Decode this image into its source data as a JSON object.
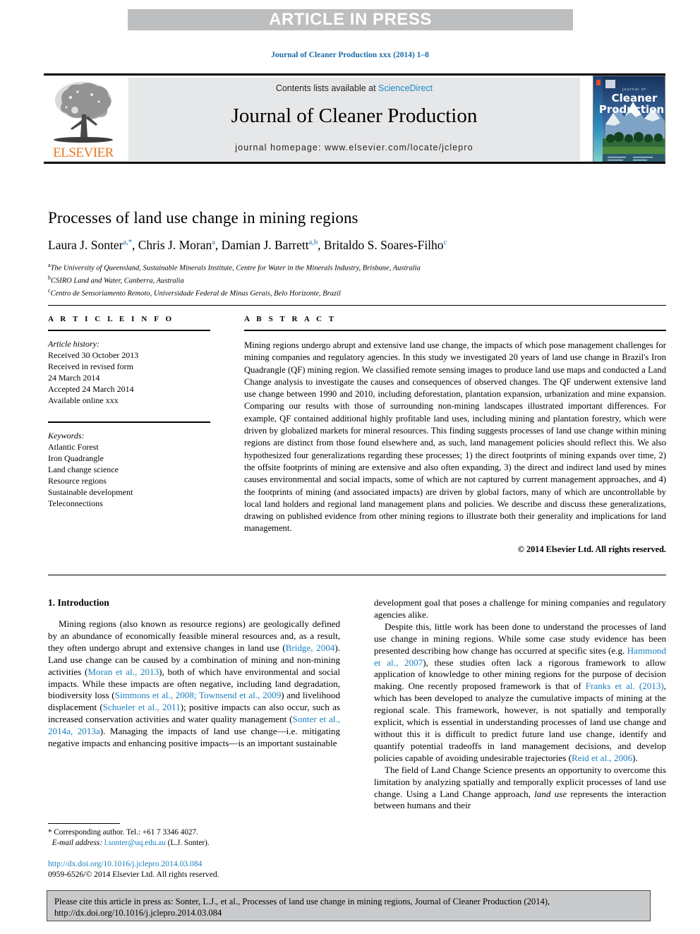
{
  "banner": {
    "text": "ARTICLE IN PRESS"
  },
  "journal_ref": "Journal of Cleaner Production xxx (2014) 1–8",
  "masthead": {
    "contents_prefix": "Contents lists available at ",
    "contents_link": "ScienceDirect",
    "journal_title": "Journal of Cleaner Production",
    "homepage": "journal homepage: www.elsevier.com/locate/jclepro",
    "publisher_word": "ELSEVIER",
    "publisher_color": "#E87722",
    "link_color": "#1b8ac7",
    "cover_title_line1": "Cleaner",
    "cover_title_line2": "Production",
    "cover_overline": "Journal of"
  },
  "article": {
    "title": "Processes of land use change in mining regions",
    "authors": [
      {
        "name": "Laura J. Sonter",
        "sup": "a,*"
      },
      {
        "name": "Chris J. Moran",
        "sup": "a"
      },
      {
        "name": "Damian J. Barrett",
        "sup": "a,b"
      },
      {
        "name": "Britaldo S. Soares-Filho",
        "sup": "c"
      }
    ],
    "affiliations": [
      {
        "marker": "a",
        "text": "The University of Queensland, Sustainable Minerals Institute, Centre for Water in the Minerals Industry, Brisbane, Australia"
      },
      {
        "marker": "b",
        "text": "CSIRO Land and Water, Canberra, Australia"
      },
      {
        "marker": "c",
        "text": "Centro de Sensoriamento Remoto, Universidade Federal de Minas Gerais, Belo Horizonte, Brazil"
      }
    ]
  },
  "info": {
    "heading": "A R T I C L E   I N F O",
    "history_label": "Article history:",
    "history": [
      "Received 30 October 2013",
      "Received in revised form",
      "24 March 2014",
      "Accepted 24 March 2014",
      "Available online xxx"
    ],
    "keywords_label": "Keywords:",
    "keywords": [
      "Atlantic Forest",
      "Iron Quadrangle",
      "Land change science",
      "Resource regions",
      "Sustainable development",
      "Teleconnections"
    ]
  },
  "abstract": {
    "heading": "A B S T R A C T",
    "text": "Mining regions undergo abrupt and extensive land use change, the impacts of which pose management challenges for mining companies and regulatory agencies. In this study we investigated 20 years of land use change in Brazil's Iron Quadrangle (QF) mining region. We classified remote sensing images to produce land use maps and conducted a Land Change analysis to investigate the causes and consequences of observed changes. The QF underwent extensive land use change between 1990 and 2010, including deforestation, plantation expansion, urbanization and mine expansion. Comparing our results with those of surrounding non-mining landscapes illustrated important differences. For example, QF contained additional highly profitable land uses, including mining and plantation forestry, which were driven by globalized markets for mineral resources. This finding suggests processes of land use change within mining regions are distinct from those found elsewhere and, as such, land management policies should reflect this. We also hypothesized four generalizations regarding these processes; 1) the direct footprints of mining expands over time, 2) the offsite footprints of mining are extensive and also often expanding, 3) the direct and indirect land used by mines causes environmental and social impacts, some of which are not captured by current management approaches, and 4) the footprints of mining (and associated impacts) are driven by global factors, many of which are uncontrollable by local land holders and regional land management plans and policies. We describe and discuss these generalizations, drawing on published evidence from other mining regions to illustrate both their generality and implications for land management.",
    "copyright": "© 2014 Elsevier Ltd. All rights reserved."
  },
  "intro": {
    "heading": "1.  Introduction",
    "left_p1_a": "Mining regions (also known as resource regions) are geologically defined by an abundance of economically feasible mineral resources and, as a result, they often undergo abrupt and extensive changes in land use (",
    "left_p1_cite1": "Bridge, 2004",
    "left_p1_b": "). Land use change can be caused by a combination of mining and non-mining activities (",
    "left_p1_cite2": "Moran et al., 2013",
    "left_p1_c": "), both of which have environmental and social impacts. While these impacts are often negative, including land degradation, biodiversity loss (",
    "left_p1_cite3": "Simmons et al., 2008; Townsend et al., 2009",
    "left_p1_d": ") and livelihood displacement (",
    "left_p1_cite4": "Schueler et al., 2011",
    "left_p1_e": "); positive impacts can also occur, such as increased conservation activities and water quality management (",
    "left_p1_cite5": "Sonter et al., 2014a, 2013a",
    "left_p1_f": "). Managing the impacts of land use change—i.e. mitigating negative impacts and enhancing positive impacts—is an important sustainable",
    "right_p1_cont": "development goal that poses a challenge for mining companies and regulatory agencies alike.",
    "right_p2_a": "Despite this, little work has been done to understand the processes of land use change in mining regions. While some case study evidence has been presented describing how change has occurred at specific sites (e.g. ",
    "right_p2_cite1": "Hammond et al., 2007",
    "right_p2_b": "), these studies often lack a rigorous framework to allow application of knowledge to other mining regions for the purpose of decision making. One recently proposed framework is that of ",
    "right_p2_cite2": "Franks et al. (2013)",
    "right_p2_c": ", which has been developed to analyze the cumulative impacts of mining at the regional scale. This framework, however, is not spatially and temporally explicit, which is essential in understanding processes of land use change and without this it is difficult to predict future land use change, identify and quantify potential tradeoffs in land management decisions, and develop policies capable of avoiding undesirable trajectories (",
    "right_p2_cite3": "Reid et al., 2006",
    "right_p2_d": ").",
    "right_p3_a": "The field of Land Change Science presents an opportunity to overcome this limitation by analyzing spatially and temporally explicit processes of land use change. Using a Land Change approach, ",
    "right_p3_ital": "land use",
    "right_p3_b": " represents the interaction between humans and their"
  },
  "footnote": {
    "corresponding": "* Corresponding author. Tel.: +61 7 3346 4027.",
    "email_label": "E-mail address:",
    "email": "l.sonter@uq.edu.au",
    "email_suffix": "(L.J. Sonter).",
    "doi": "http://dx.doi.org/10.1016/j.jclepro.2014.03.084",
    "issn_line": "0959-6526/© 2014 Elsevier Ltd. All rights reserved."
  },
  "cite_footer": {
    "text": "Please cite this article in press as: Sonter, L.J., et al., Processes of land use change in mining regions, Journal of Cleaner Production (2014), http://dx.doi.org/10.1016/j.jclepro.2014.03.084"
  }
}
